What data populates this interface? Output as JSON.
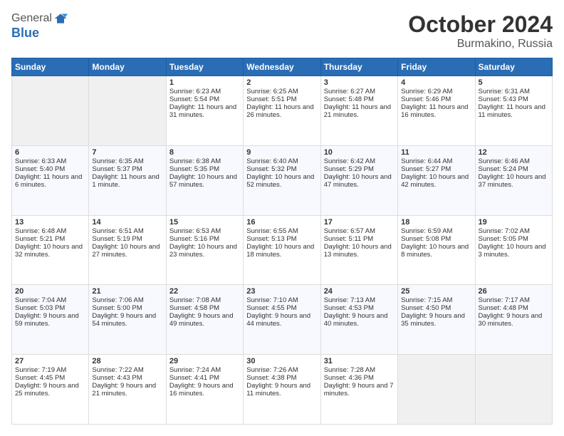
{
  "logo": {
    "general": "General",
    "blue": "Blue"
  },
  "title": {
    "month_year": "October 2024",
    "location": "Burmakino, Russia"
  },
  "headers": [
    "Sunday",
    "Monday",
    "Tuesday",
    "Wednesday",
    "Thursday",
    "Friday",
    "Saturday"
  ],
  "rows": [
    [
      {
        "day": "",
        "sun": "",
        "set": "",
        "day_hours": ""
      },
      {
        "day": "",
        "sun": "",
        "set": "",
        "day_hours": ""
      },
      {
        "day": "1",
        "sun": "Sunrise: 6:23 AM",
        "set": "Sunset: 5:54 PM",
        "day_hours": "Daylight: 11 hours and 31 minutes."
      },
      {
        "day": "2",
        "sun": "Sunrise: 6:25 AM",
        "set": "Sunset: 5:51 PM",
        "day_hours": "Daylight: 11 hours and 26 minutes."
      },
      {
        "day": "3",
        "sun": "Sunrise: 6:27 AM",
        "set": "Sunset: 5:48 PM",
        "day_hours": "Daylight: 11 hours and 21 minutes."
      },
      {
        "day": "4",
        "sun": "Sunrise: 6:29 AM",
        "set": "Sunset: 5:46 PM",
        "day_hours": "Daylight: 11 hours and 16 minutes."
      },
      {
        "day": "5",
        "sun": "Sunrise: 6:31 AM",
        "set": "Sunset: 5:43 PM",
        "day_hours": "Daylight: 11 hours and 11 minutes."
      }
    ],
    [
      {
        "day": "6",
        "sun": "Sunrise: 6:33 AM",
        "set": "Sunset: 5:40 PM",
        "day_hours": "Daylight: 11 hours and 6 minutes."
      },
      {
        "day": "7",
        "sun": "Sunrise: 6:35 AM",
        "set": "Sunset: 5:37 PM",
        "day_hours": "Daylight: 11 hours and 1 minute."
      },
      {
        "day": "8",
        "sun": "Sunrise: 6:38 AM",
        "set": "Sunset: 5:35 PM",
        "day_hours": "Daylight: 10 hours and 57 minutes."
      },
      {
        "day": "9",
        "sun": "Sunrise: 6:40 AM",
        "set": "Sunset: 5:32 PM",
        "day_hours": "Daylight: 10 hours and 52 minutes."
      },
      {
        "day": "10",
        "sun": "Sunrise: 6:42 AM",
        "set": "Sunset: 5:29 PM",
        "day_hours": "Daylight: 10 hours and 47 minutes."
      },
      {
        "day": "11",
        "sun": "Sunrise: 6:44 AM",
        "set": "Sunset: 5:27 PM",
        "day_hours": "Daylight: 10 hours and 42 minutes."
      },
      {
        "day": "12",
        "sun": "Sunrise: 6:46 AM",
        "set": "Sunset: 5:24 PM",
        "day_hours": "Daylight: 10 hours and 37 minutes."
      }
    ],
    [
      {
        "day": "13",
        "sun": "Sunrise: 6:48 AM",
        "set": "Sunset: 5:21 PM",
        "day_hours": "Daylight: 10 hours and 32 minutes."
      },
      {
        "day": "14",
        "sun": "Sunrise: 6:51 AM",
        "set": "Sunset: 5:19 PM",
        "day_hours": "Daylight: 10 hours and 27 minutes."
      },
      {
        "day": "15",
        "sun": "Sunrise: 6:53 AM",
        "set": "Sunset: 5:16 PM",
        "day_hours": "Daylight: 10 hours and 23 minutes."
      },
      {
        "day": "16",
        "sun": "Sunrise: 6:55 AM",
        "set": "Sunset: 5:13 PM",
        "day_hours": "Daylight: 10 hours and 18 minutes."
      },
      {
        "day": "17",
        "sun": "Sunrise: 6:57 AM",
        "set": "Sunset: 5:11 PM",
        "day_hours": "Daylight: 10 hours and 13 minutes."
      },
      {
        "day": "18",
        "sun": "Sunrise: 6:59 AM",
        "set": "Sunset: 5:08 PM",
        "day_hours": "Daylight: 10 hours and 8 minutes."
      },
      {
        "day": "19",
        "sun": "Sunrise: 7:02 AM",
        "set": "Sunset: 5:05 PM",
        "day_hours": "Daylight: 10 hours and 3 minutes."
      }
    ],
    [
      {
        "day": "20",
        "sun": "Sunrise: 7:04 AM",
        "set": "Sunset: 5:03 PM",
        "day_hours": "Daylight: 9 hours and 59 minutes."
      },
      {
        "day": "21",
        "sun": "Sunrise: 7:06 AM",
        "set": "Sunset: 5:00 PM",
        "day_hours": "Daylight: 9 hours and 54 minutes."
      },
      {
        "day": "22",
        "sun": "Sunrise: 7:08 AM",
        "set": "Sunset: 4:58 PM",
        "day_hours": "Daylight: 9 hours and 49 minutes."
      },
      {
        "day": "23",
        "sun": "Sunrise: 7:10 AM",
        "set": "Sunset: 4:55 PM",
        "day_hours": "Daylight: 9 hours and 44 minutes."
      },
      {
        "day": "24",
        "sun": "Sunrise: 7:13 AM",
        "set": "Sunset: 4:53 PM",
        "day_hours": "Daylight: 9 hours and 40 minutes."
      },
      {
        "day": "25",
        "sun": "Sunrise: 7:15 AM",
        "set": "Sunset: 4:50 PM",
        "day_hours": "Daylight: 9 hours and 35 minutes."
      },
      {
        "day": "26",
        "sun": "Sunrise: 7:17 AM",
        "set": "Sunset: 4:48 PM",
        "day_hours": "Daylight: 9 hours and 30 minutes."
      }
    ],
    [
      {
        "day": "27",
        "sun": "Sunrise: 7:19 AM",
        "set": "Sunset: 4:45 PM",
        "day_hours": "Daylight: 9 hours and 25 minutes."
      },
      {
        "day": "28",
        "sun": "Sunrise: 7:22 AM",
        "set": "Sunset: 4:43 PM",
        "day_hours": "Daylight: 9 hours and 21 minutes."
      },
      {
        "day": "29",
        "sun": "Sunrise: 7:24 AM",
        "set": "Sunset: 4:41 PM",
        "day_hours": "Daylight: 9 hours and 16 minutes."
      },
      {
        "day": "30",
        "sun": "Sunrise: 7:26 AM",
        "set": "Sunset: 4:38 PM",
        "day_hours": "Daylight: 9 hours and 11 minutes."
      },
      {
        "day": "31",
        "sun": "Sunrise: 7:28 AM",
        "set": "Sunset: 4:36 PM",
        "day_hours": "Daylight: 9 hours and 7 minutes."
      },
      {
        "day": "",
        "sun": "",
        "set": "",
        "day_hours": ""
      },
      {
        "day": "",
        "sun": "",
        "set": "",
        "day_hours": ""
      }
    ]
  ]
}
